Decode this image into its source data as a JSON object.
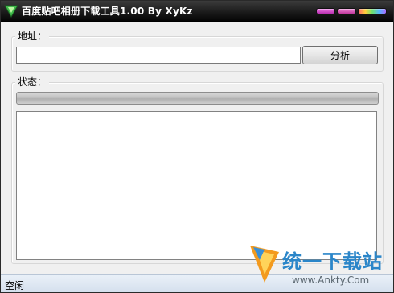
{
  "window": {
    "title": "百度贴吧相册下载工具1.00 By XyKz",
    "buttons": [
      "minimize",
      "maximize",
      "close"
    ]
  },
  "address_group": {
    "label": "地址：",
    "url_value": "",
    "analyze_button": "分析"
  },
  "status_group": {
    "label": "状态：",
    "progress": 0,
    "log_text": ""
  },
  "statusbar": {
    "text": "空闲"
  },
  "watermark": {
    "brand": "统一下载站",
    "url": "www.Ankty.Com"
  },
  "colors": {
    "titlebar": "#1c1c1c",
    "statusbar": "#d4dfed",
    "watermark": "#2b86c9"
  }
}
